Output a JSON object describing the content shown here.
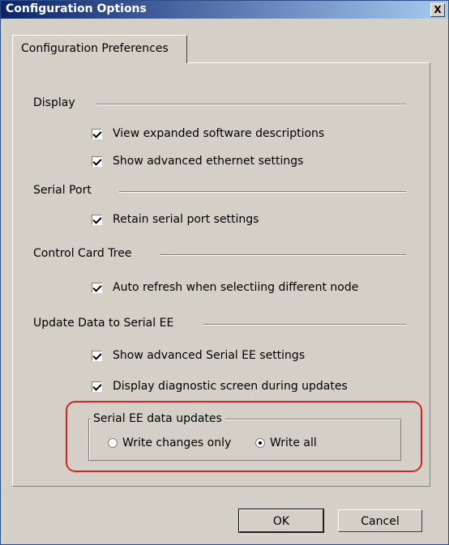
{
  "window": {
    "title": "Configuration Options",
    "close_label": "X"
  },
  "tab": {
    "label": "Configuration Preferences"
  },
  "sections": {
    "display": "Display",
    "serial_port": "Serial Port",
    "control_card_tree": "Control Card Tree",
    "update_data": "Update Data to Serial EE"
  },
  "checks": {
    "view_expanded": {
      "label": "View expanded software descriptions",
      "checked": true
    },
    "show_ethernet": {
      "label": "Show advanced ethernet settings",
      "checked": true
    },
    "retain_serial": {
      "label": "Retain serial port settings",
      "checked": true
    },
    "auto_refresh": {
      "label": "Auto refresh when selectiing different node",
      "checked": true
    },
    "show_serial_ee": {
      "label": "Show advanced Serial EE settings",
      "checked": true
    },
    "display_diag": {
      "label": "Display diagnostic screen during updates",
      "checked": true
    }
  },
  "serial_ee_group": {
    "title": "Serial EE data updates",
    "write_changes_only": {
      "label": "Write changes only",
      "selected": false
    },
    "write_all": {
      "label": "Write all",
      "selected": true
    }
  },
  "buttons": {
    "ok": "OK",
    "cancel": "Cancel"
  },
  "colors": {
    "highlight": "#e02020",
    "titlebar": "#0a246a"
  }
}
